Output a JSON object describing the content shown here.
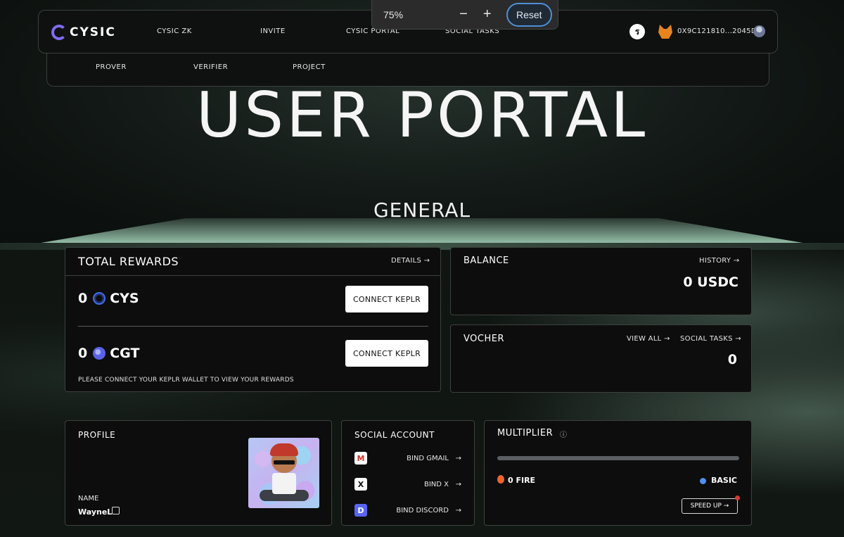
{
  "zoom": {
    "value": "75%",
    "minus": "−",
    "plus": "+",
    "reset": "Reset"
  },
  "header": {
    "logo": "CYSIC",
    "nav": [
      "CYSIC ZK",
      "INVITE",
      "CYSIC PORTAL",
      "SOCIAL TASKS"
    ],
    "faucet_glyph": "ร",
    "wallet_address": "0X9C121810...2045D"
  },
  "subnav": [
    "PROVER",
    "VERIFIER",
    "PROJECT"
  ],
  "hero_title": "USER PORTAL",
  "section_title": "GENERAL",
  "rewards": {
    "title": "TOTAL REWARDS",
    "details": "DETAILS →",
    "tokens": [
      {
        "amount": "0",
        "symbol": "CYS",
        "button": "CONNECT KEPLR"
      },
      {
        "amount": "0",
        "symbol": "CGT",
        "button": "CONNECT KEPLR"
      }
    ],
    "hint": "PLEASE CONNECT YOUR KEPLR WALLET TO VIEW YOUR REWARDS"
  },
  "balance": {
    "title": "BALANCE",
    "history": "HISTORY →",
    "value": "0 USDC"
  },
  "voucher": {
    "title": "VOCHER",
    "view_all": "VIEW ALL →",
    "social_tasks": "SOCIAL TASKS →",
    "value": "0"
  },
  "profile": {
    "title": "PROFILE",
    "name_label": "NAME",
    "name_value": "WayneL"
  },
  "social": {
    "title": "SOCIAL ACCOUNT",
    "items": [
      {
        "label": "BIND GMAIL",
        "icon": "gmail-icon"
      },
      {
        "label": "BIND X",
        "icon": "x-icon"
      },
      {
        "label": "BIND DISCORD",
        "icon": "discord-icon"
      }
    ],
    "arrow": "→"
  },
  "multiplier": {
    "title": "MULTIPLIER",
    "info": "ⓘ",
    "progress": 0,
    "fire": "0 FIRE",
    "level": "BASIC",
    "speed_up": "SPEED UP →"
  },
  "colors": {
    "accent": "#7e6cf6",
    "level_dot": "#4f8ff0",
    "fire": "#f0622d",
    "notification": "#d23b3b"
  }
}
